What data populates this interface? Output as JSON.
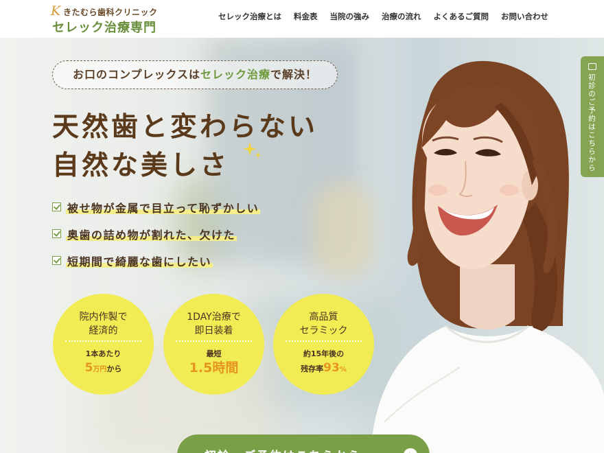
{
  "header": {
    "logo_mark": "K",
    "clinic_name": "きたむら歯科クリニック",
    "site_title": "セレック治療専門",
    "nav": [
      "セレック治療とは",
      "料金表",
      "当院の強み",
      "治療の流れ",
      "よくあるご質問",
      "お問い合わせ"
    ]
  },
  "hero": {
    "tagline_pre": "お口のコンプレックスは",
    "tagline_accent": "セレック治療",
    "tagline_post": "で解決！",
    "headline_line1": "天然歯と変わらない",
    "headline_line2": "自然な美しさ",
    "checklist": [
      "被せ物が金属で目立って恥ずかしい",
      "奥歯の詰め物が割れた、欠けた",
      "短期間で綺麗な歯にしたい"
    ],
    "features": [
      {
        "head1": "院内作製で",
        "head2": "経済的",
        "foot1": "1本あたり",
        "big": "5",
        "unit": "万円",
        "tail": "から"
      },
      {
        "head1": "1DAY治療で",
        "head2": "即日装着",
        "foot1": "最短",
        "big": "1.5時間",
        "unit": "",
        "tail": ""
      },
      {
        "head1": "高品質",
        "head2": "セラミック",
        "foot1": "約15年後の",
        "pre": "残存率",
        "big": "93",
        "unit": "%",
        "tail": ""
      }
    ],
    "cta_label": "初診・ご予約はこちらから",
    "cta_icon": "›"
  },
  "side_tab": {
    "label": "初診のご予約はこちらから",
    "icon": "calendar-icon"
  },
  "colors": {
    "brand_green": "#7aa047",
    "brown": "#5b3a1c",
    "circle_yellow": "#f2ec54",
    "accent_orange": "#e69420"
  }
}
